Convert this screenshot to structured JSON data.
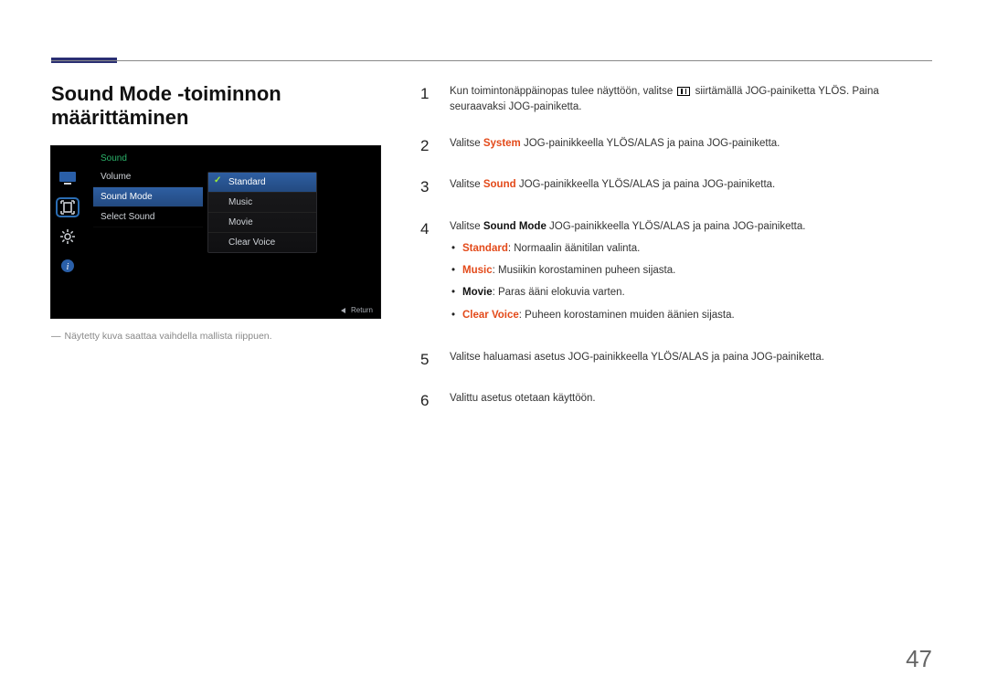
{
  "page_number": "47",
  "section_title": "Sound Mode ‑toiminnon määrittäminen",
  "caption": "Näytetty kuva saattaa vaihdella mallista riippuen.",
  "osd": {
    "title": "Sound",
    "menu": [
      "Volume",
      "Sound Mode",
      "Select Sound"
    ],
    "menu_selected_index": 1,
    "options": [
      "Standard",
      "Music",
      "Movie",
      "Clear Voice"
    ],
    "option_selected_index": 0,
    "return_label": "Return"
  },
  "steps": {
    "s1": {
      "num": "1",
      "pre": "Kun toimintonäppäinopas tulee näyttöön, valitse ",
      "post": " siirtämällä JOG-painiketta YLÖS. Paina seuraavaksi JOG-painiketta."
    },
    "s2": {
      "num": "2",
      "pre": "Valitse ",
      "hl": "System",
      "post": " JOG-painikkeella YLÖS/ALAS ja paina JOG-painiketta."
    },
    "s3": {
      "num": "3",
      "pre": "Valitse ",
      "hl": "Sound",
      "post": " JOG-painikkeella YLÖS/ALAS ja paina JOG-painiketta."
    },
    "s4": {
      "num": "4",
      "pre": "Valitse ",
      "hl": "Sound Mode",
      "post": " JOG-painikkeella YLÖS/ALAS ja paina JOG-painiketta."
    },
    "s5": {
      "num": "5",
      "text": "Valitse haluamasi asetus JOG-painikkeella YLÖS/ALAS ja paina JOG-painiketta."
    },
    "s6": {
      "num": "6",
      "text": "Valittu asetus otetaan käyttöön."
    }
  },
  "bullets": {
    "b1": {
      "hl": "Standard",
      "rest": ": Normaalin äänitilan valinta."
    },
    "b2": {
      "hl": "Music",
      "rest": ": Musiikin korostaminen puheen sijasta."
    },
    "b3": {
      "hl": "Movie",
      "rest": ": Paras ääni elokuvia varten."
    },
    "b4": {
      "hl": "Clear Voice",
      "rest": ": Puheen korostaminen muiden äänien sijasta."
    }
  }
}
